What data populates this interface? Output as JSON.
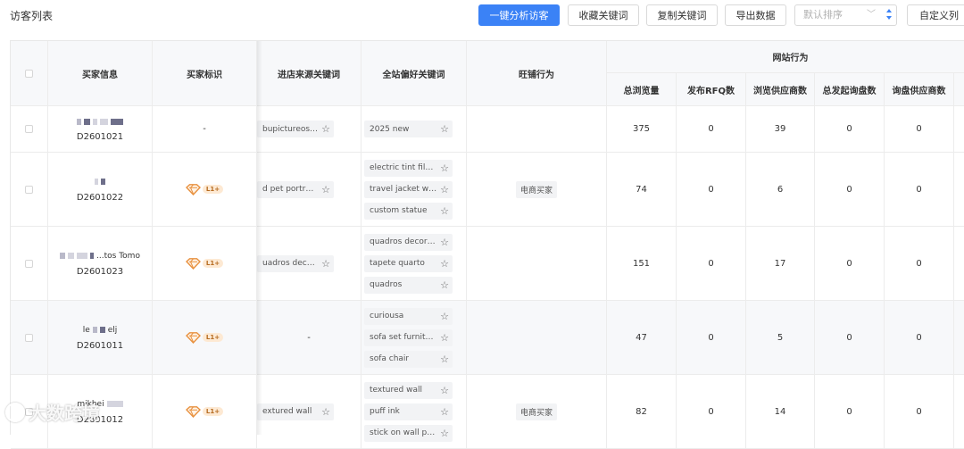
{
  "page": {
    "title": "访客列表"
  },
  "toolbar": {
    "analyze_label": "一键分析访客",
    "collect_label": "收藏关键词",
    "copy_label": "复制关键词",
    "export_label": "导出数据",
    "sort_placeholder": "默认排序",
    "custom_label": "自定义列"
  },
  "table": {
    "headers": {
      "buyer_info": "买家信息",
      "buyer_mark": "买家标识",
      "entry_keyword": "进店来源关键词",
      "site_keyword": "全站偏好关键词",
      "wangwang": "旺铺行为",
      "site_behavior": "网站行为",
      "total_views": "总浏览量",
      "rfq_count": "发布RFQ数",
      "suppliers_viewed": "浏览供应商数",
      "inquiries": "总发起询盘数",
      "inquiry_suppliers": "询盘供应商数"
    },
    "rows": [
      {
        "name": "",
        "id": "D2601021",
        "mark": "-",
        "entry_keyword": "bupictureossu...",
        "site_keywords": [
          "2025 new"
        ],
        "wangwang": "",
        "total_views": "375",
        "rfq": "0",
        "suppliers_viewed": "39",
        "inquiries": "0",
        "inquiry_suppliers": "0"
      },
      {
        "name": "",
        "id": "D2601022",
        "mark": "L1+",
        "entry_keyword": "d pet portraitic...",
        "site_keywords": [
          "electric tint film f...",
          "travel jacket wit...",
          "custom statue"
        ],
        "wangwang": "电商买家",
        "total_views": "74",
        "rfq": "0",
        "suppliers_viewed": "6",
        "inquiries": "0",
        "inquiry_suppliers": "0"
      },
      {
        "name": "...tos Tomo",
        "id": "D2601023",
        "mark": "L1+",
        "entry_keyword": "uadros decora...",
        "site_keywords": [
          "quadros decora...",
          "tapete quarto",
          "quadros"
        ],
        "wangwang": "",
        "total_views": "151",
        "rfq": "0",
        "suppliers_viewed": "17",
        "inquiries": "0",
        "inquiry_suppliers": "0"
      },
      {
        "name_prefix": "le",
        "name_suffix": "elj",
        "id": "D2601011",
        "mark": "L1+",
        "entry_keyword": "-",
        "site_keywords": [
          "curiousa",
          "sofa set furnitur...",
          "sofa chair"
        ],
        "wangwang": "",
        "total_views": "47",
        "rfq": "0",
        "suppliers_viewed": "5",
        "inquiries": "0",
        "inquiry_suppliers": "0"
      },
      {
        "name_prefix": "mikhei",
        "id": "D2601012",
        "mark": "L1+",
        "entry_keyword": "extured wall",
        "site_keywords": [
          "textured wall",
          "puff ink",
          "stick on wall pa..."
        ],
        "wangwang": "电商买家",
        "total_views": "82",
        "rfq": "0",
        "suppliers_viewed": "14",
        "inquiries": "0",
        "inquiry_suppliers": "0"
      }
    ]
  },
  "watermark": {
    "text": "大数跨境"
  },
  "icons": {
    "star": "star-icon",
    "diamond": "diamond-badge-icon",
    "chevron": "chevron-down-icon"
  },
  "colors": {
    "primary": "#3b82f6",
    "badge": "#e8913f"
  }
}
